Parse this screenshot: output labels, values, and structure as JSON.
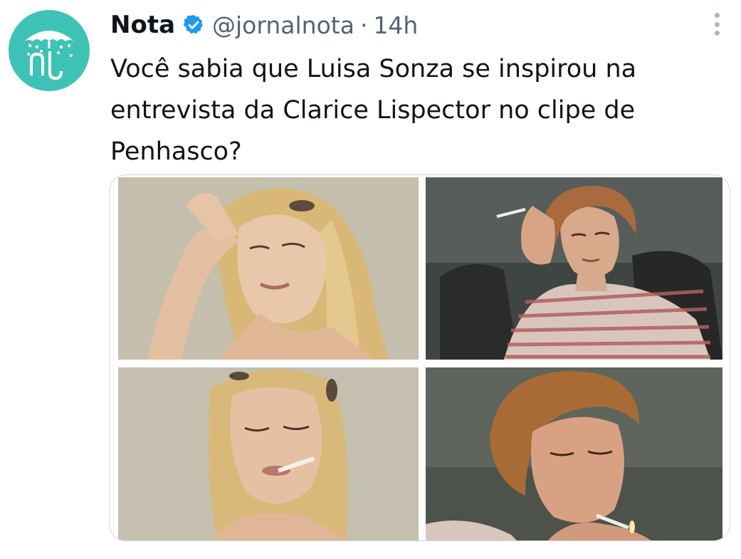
{
  "account": {
    "name": "Nota",
    "handle": "@jornalnota",
    "separator": "·",
    "time": "14h",
    "verified": true,
    "avatar_icon": "umbrella-nota-logo",
    "avatar_color": "#3ec2b6"
  },
  "tweet": {
    "text": "Você sabia que Luisa Sonza se inspirou na entrevista da Clarice Lispector no clipe de Penhasco?"
  },
  "media": {
    "count": 4
  },
  "colors": {
    "verified_badge": "#1d9bf0",
    "secondary_text": "#536471"
  }
}
